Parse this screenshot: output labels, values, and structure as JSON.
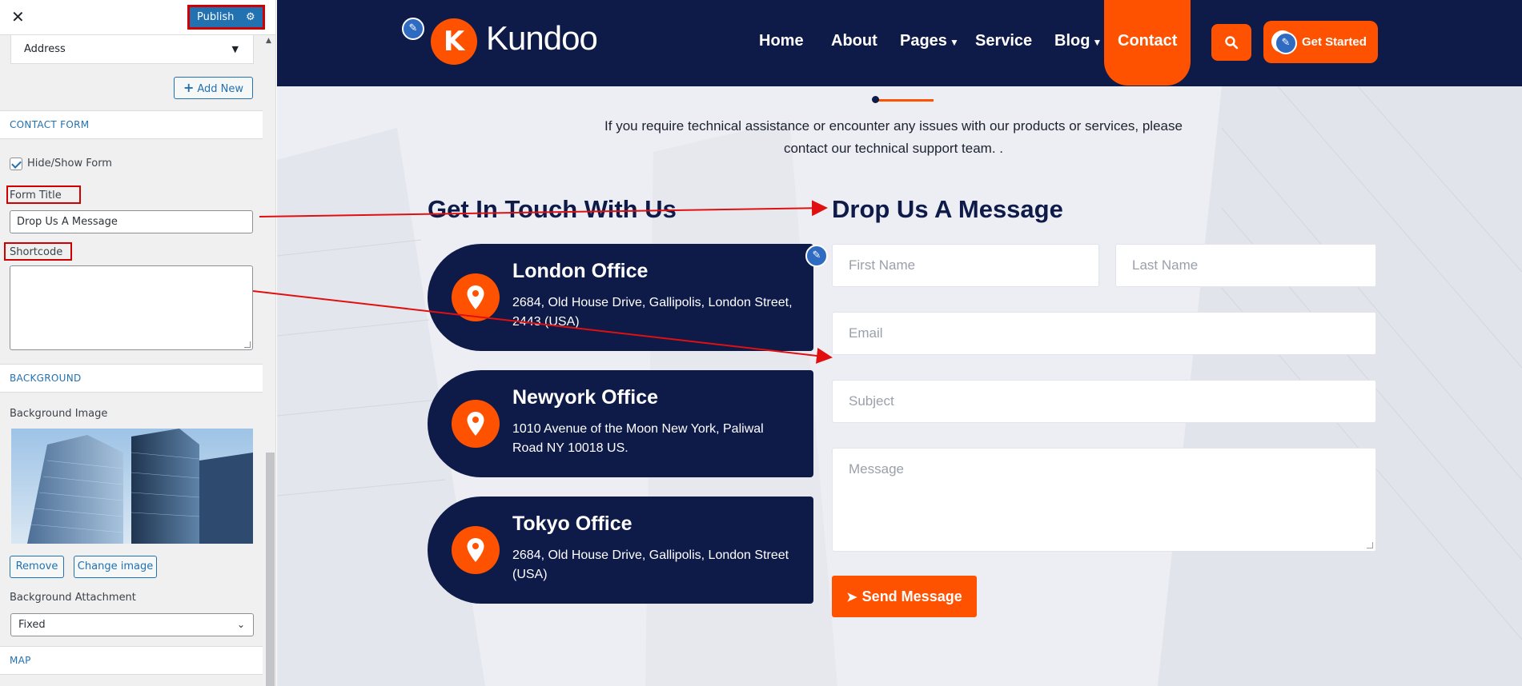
{
  "sidebar": {
    "close_label": "✕",
    "publish_label": "Publish",
    "address_select_value": "Address",
    "add_new_label": "Add New",
    "contact_form_heading": "CONTACT FORM",
    "hide_show_label": "Hide/Show Form",
    "hide_show_checked": true,
    "form_title_label": "Form Title",
    "form_title_value": "Drop Us A Message",
    "shortcode_label": "Shortcode",
    "shortcode_value": "",
    "background_heading": "BACKGROUND",
    "background_image_label": "Background Image",
    "remove_label": "Remove",
    "change_image_label": "Change image",
    "background_attachment_label": "Background Attachment",
    "background_attachment_value": "Fixed",
    "map_heading": "MAP"
  },
  "site": {
    "logo_letter": "K",
    "logo_text": "Kundoo",
    "nav": [
      {
        "label": "Home"
      },
      {
        "label": "About"
      },
      {
        "label": "Pages"
      },
      {
        "label": "Service"
      },
      {
        "label": "Blog"
      },
      {
        "label": "Contact"
      }
    ],
    "get_started_label": "Get Started",
    "intro_line_1": "If you require technical assistance or encounter any issues with our products or services, please",
    "intro_line_2": "contact our technical support team. .",
    "touch_title": "Get In Touch With Us",
    "form_title": "Drop Us A Message",
    "offices": [
      {
        "name": "London Office",
        "address": "2684, Old House Drive, Gallipolis, London Street, 2443 (USA)"
      },
      {
        "name": "Newyork Office",
        "address": "1010 Avenue of the Moon New York, Paliwal Road NY 10018 US."
      },
      {
        "name": "Tokyo Office",
        "address": "2684, Old House Drive, Gallipolis, London Street (USA)"
      }
    ],
    "form": {
      "first_name_placeholder": "First Name",
      "last_name_placeholder": "Last Name",
      "email_placeholder": "Email",
      "subject_placeholder": "Subject",
      "message_placeholder": "Message",
      "send_label": "Send Message"
    }
  },
  "colors": {
    "navy": "#0e1a48",
    "orange": "#ff5200",
    "wp_blue": "#2271b1",
    "annotation_red": "#d10000"
  }
}
